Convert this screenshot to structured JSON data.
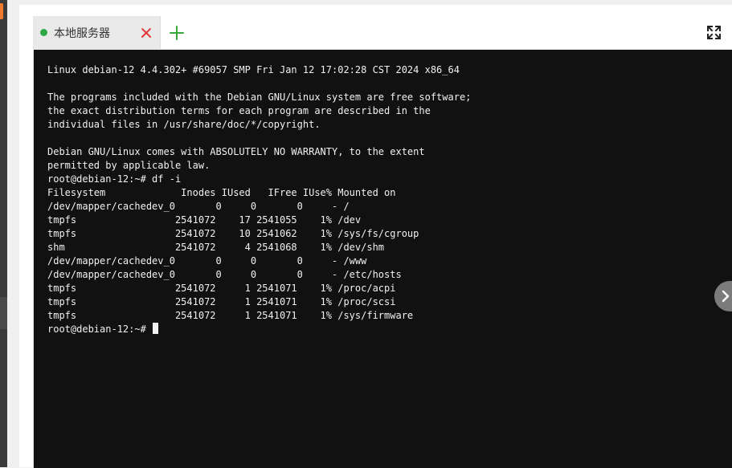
{
  "colors": {
    "status_dot": "#2ea844",
    "close": "#e23b3b",
    "add": "#36a83e",
    "terminal_bg": "#111111",
    "terminal_fg": "#f1f1f1"
  },
  "tabs": [
    {
      "label": "本地服务器",
      "status": "connected"
    }
  ],
  "terminal": {
    "lines": [
      "Linux debian-12 4.4.302+ #69057 SMP Fri Jan 12 17:02:28 CST 2024 x86_64",
      "",
      "The programs included with the Debian GNU/Linux system are free software;",
      "the exact distribution terms for each program are described in the",
      "individual files in /usr/share/doc/*/copyright.",
      "",
      "Debian GNU/Linux comes with ABSOLUTELY NO WARRANTY, to the extent",
      "permitted by applicable law.",
      "root@debian-12:~# df -i",
      "Filesystem             Inodes IUsed   IFree IUse% Mounted on",
      "/dev/mapper/cachedev_0       0     0       0     - /",
      "tmpfs                 2541072    17 2541055    1% /dev",
      "tmpfs                 2541072    10 2541062    1% /sys/fs/cgroup",
      "shm                   2541072     4 2541068    1% /dev/shm",
      "/dev/mapper/cachedev_0       0     0       0     - /www",
      "/dev/mapper/cachedev_0       0     0       0     - /etc/hosts",
      "tmpfs                 2541072     1 2541071    1% /proc/acpi",
      "tmpfs                 2541072     1 2541071    1% /proc/scsi",
      "tmpfs                 2541072     1 2541071    1% /sys/firmware"
    ],
    "prompt": "root@debian-12:~# "
  },
  "icons": {
    "tab_status": "status-dot-icon",
    "tab_close": "close-icon",
    "add_tab": "plus-icon",
    "fullscreen": "expand-icon",
    "side_handle": "chevron-right-icon"
  }
}
